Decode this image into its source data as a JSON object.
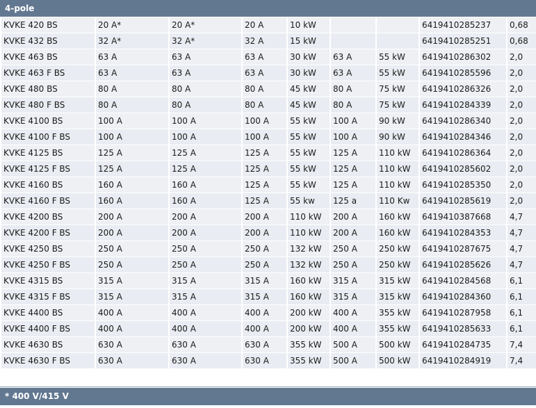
{
  "section_title": "4-pole",
  "footnote": "* 400 V/415 V",
  "rows": [
    [
      "KVKE 420 BS",
      "20 A*",
      "20 A*",
      "20 A",
      "10 kW",
      "",
      "",
      "6419410285237",
      "0,68"
    ],
    [
      "KVKE 432 BS",
      "32 A*",
      "32 A*",
      "32 A",
      "15 kW",
      "",
      "",
      "6419410285251",
      "0,68"
    ],
    [
      "KVKE 463 BS",
      "63 A",
      "63 A",
      "63 A",
      "30 kW",
      "63 A",
      "55 kW",
      "6419410286302",
      "2,0"
    ],
    [
      "KVKE 463 F BS",
      "63 A",
      "63 A",
      "63 A",
      "30 kW",
      "63 A",
      "55 kW",
      "6419410285596",
      "2,0"
    ],
    [
      "KVKE 480 BS",
      "80 A",
      "80 A",
      "80 A",
      "45 kW",
      "80 A",
      "75 kW",
      "6419410286326",
      "2,0"
    ],
    [
      "KVKE 480 F BS",
      "80 A",
      "80 A",
      "80 A",
      "45 kW",
      "80 A",
      "75 kW",
      "6419410284339",
      "2,0"
    ],
    [
      "KVKE 4100 BS",
      "100 A",
      "100 A",
      "100 A",
      "55 kW",
      "100 A",
      "90 kW",
      "6419410286340",
      "2,0"
    ],
    [
      "KVKE 4100 F BS",
      "100 A",
      "100 A",
      "100 A",
      "55 kW",
      "100 A",
      "90 kW",
      "6419410284346",
      "2,0"
    ],
    [
      "KVKE 4125 BS",
      "125 A",
      "125 A",
      "125 A",
      "55 kW",
      "125 A",
      "110 kW",
      "6419410286364",
      "2,0"
    ],
    [
      "KVKE 4125 F BS",
      "125 A",
      "125 A",
      "125 A",
      "55 kW",
      "125 A",
      "110 kW",
      "6419410285602",
      "2,0"
    ],
    [
      "KVKE 4160 BS",
      "160 A",
      "160 A",
      "125 A",
      "55 kW",
      "125 A",
      "110 kW",
      "6419410285350",
      "2,0"
    ],
    [
      "KVKE 4160 F BS",
      "160 A",
      "160 A",
      "125 A",
      "55 kw",
      "125 a",
      "110 Kw",
      "6419410285619",
      "2,0"
    ],
    [
      "KVKE 4200 BS",
      "200 A",
      "200 A",
      "200 A",
      "110 kW",
      "200 A",
      "160 kW",
      "6419410387668",
      "4,7"
    ],
    [
      "KVKE 4200 F BS",
      "200 A",
      "200 A",
      "200 A",
      "110 kW",
      "200 A",
      "160 kW",
      "6419410284353",
      "4,7"
    ],
    [
      "KVKE 4250 BS",
      "250 A",
      "250 A",
      "250 A",
      "132 kW",
      "250 A",
      "250 kW",
      "6419410287675",
      "4,7"
    ],
    [
      "KVKE 4250 F BS",
      "250 A",
      "250 A",
      "250 A",
      "132 kW",
      "250 A",
      "250 kW",
      "6419410285626",
      "4,7"
    ],
    [
      "KVKE 4315 BS",
      "315 A",
      "315 A",
      "315 A",
      "160 kW",
      "315 A",
      "315 kW",
      "6419410284568",
      "6,1"
    ],
    [
      "KVKE 4315 F BS",
      "315 A",
      "315 A",
      "315 A",
      "160 kW",
      "315 A",
      "315 kW",
      "6419410284360",
      "6,1"
    ],
    [
      "KVKE 4400 BS",
      "400 A",
      "400 A",
      "400 A",
      "200 kW",
      "400 A",
      "355 kW",
      "6419410287958",
      "6,1"
    ],
    [
      "KVKE 4400 F BS",
      "400 A",
      "400 A",
      "400 A",
      "200 kW",
      "400 A",
      "355 kW",
      "6419410285633",
      "6,1"
    ],
    [
      "KVKE 4630 BS",
      "630 A",
      "630 A",
      "630 A",
      "355 kW",
      "500 A",
      "500 kW",
      "6419410284735",
      "7,4"
    ],
    [
      "KVKE 4630 F BS",
      "630 A",
      "630 A",
      "630 A",
      "355 kW",
      "500 A",
      "500 kW",
      "6419410284919",
      "7,4"
    ]
  ]
}
